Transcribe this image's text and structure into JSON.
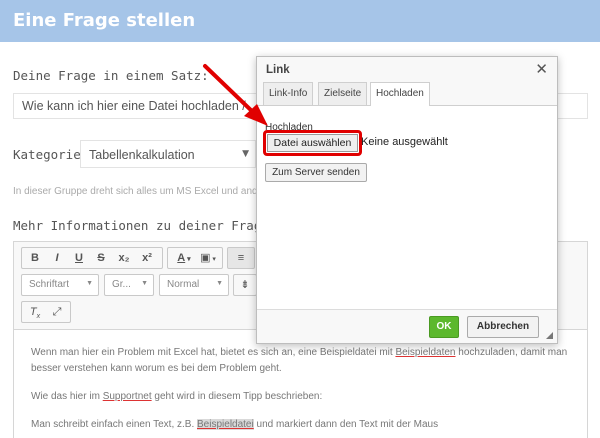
{
  "header": {
    "title": "Eine Frage stellen"
  },
  "form": {
    "question_label": "Deine Frage in einem Satz:",
    "question_value": "Wie kann ich hier eine Datei hochladen / ...",
    "category_label": "Kategorie:",
    "category_value": "Tabellenkalkulation",
    "category_hint": "In dieser Gruppe dreht sich alles um MS Excel und and...",
    "more_info_label": "Mehr Informationen zu deiner Frage:"
  },
  "editor": {
    "toolbar": {
      "bold": "B",
      "italic": "I",
      "underline": "U",
      "strike": "S",
      "subscript": "x₂",
      "superscript": "x²",
      "font_placeholder": "Schriftart",
      "size_placeholder": "Gr...",
      "format_value": "Normal"
    },
    "content": {
      "p1_a": "Wenn man hier ein Problem mit Excel hat, bietet es sich an, eine Beispieldatei mit ",
      "p1_link": "Beispieldaten",
      "p1_b": " hochzuladen, damit man besser verstehen kann worum es bei dem Problem geht.",
      "p2_a": "Wie das hier im ",
      "p2_link": "Supportnet",
      "p2_b": " geht wird in diesem Tipp beschrieben:",
      "p3_a": "Man schreibt einfach einen Text, z.B. ",
      "p3_hl": "Beispieldatei",
      "p3_b": " und markiert dann den Text mit der Maus"
    }
  },
  "dialog": {
    "title": "Link",
    "tabs": [
      "Link-Info",
      "Zielseite",
      "Hochladen"
    ],
    "active_tab": "Hochladen",
    "upload_label": "Hochladen",
    "file_button": "Datei auswählen",
    "no_file": "Keine ausgewählt",
    "send_button": "Zum Server senden",
    "ok": "OK",
    "cancel": "Abbrechen"
  },
  "colors": {
    "header": "#a6c5e8",
    "ok_green": "#5cb82d",
    "highlight_red": "#e00000"
  }
}
